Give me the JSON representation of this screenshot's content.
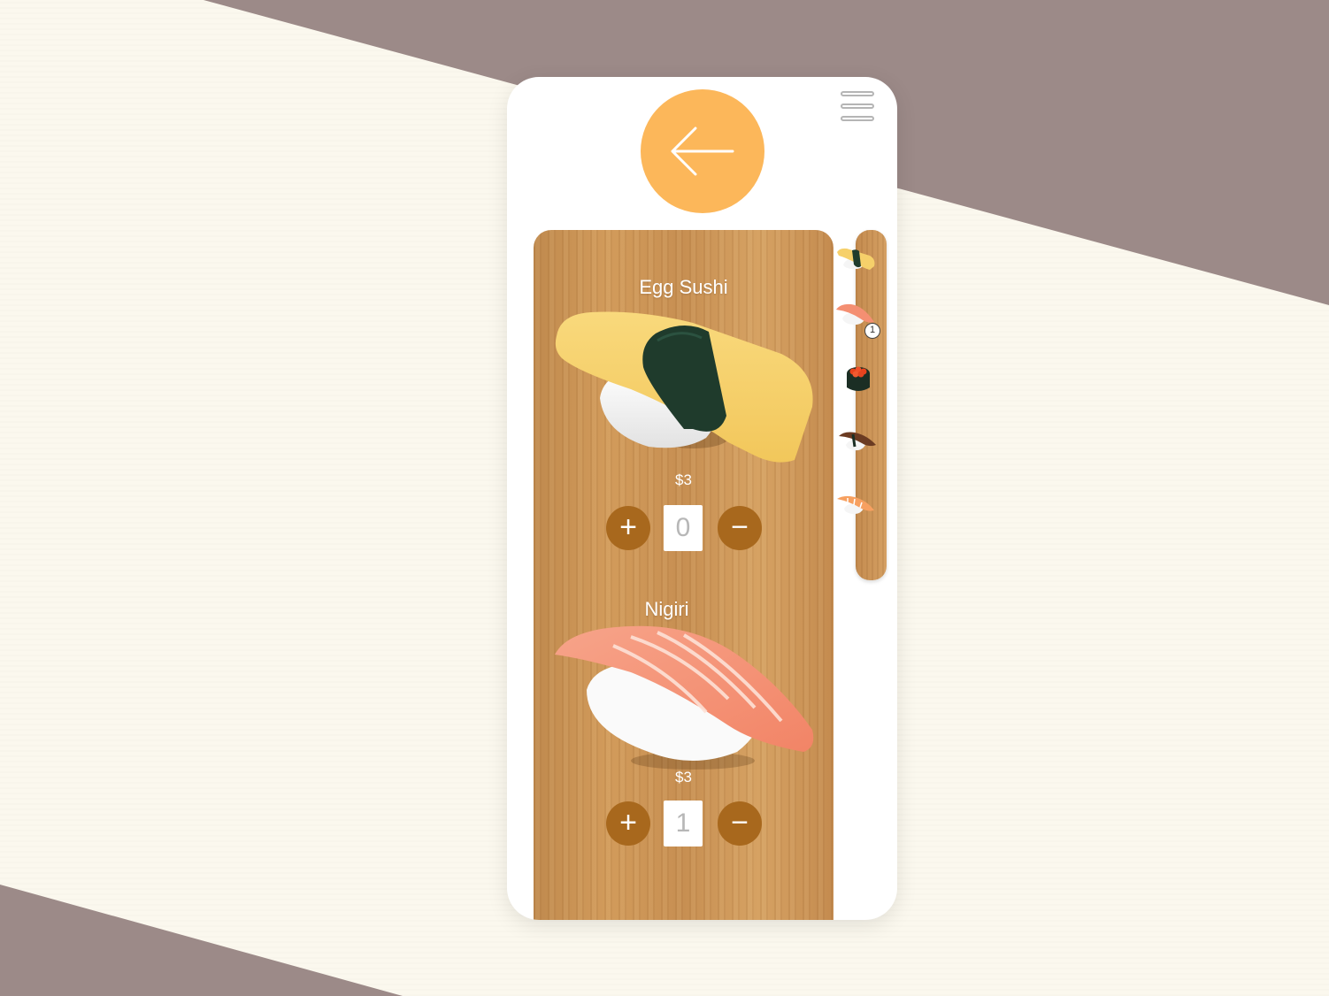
{
  "app": {
    "menu_icon": "hamburger-icon",
    "back_icon": "arrow-left-icon",
    "accent_color": "#fcb75a",
    "button_color": "#a8681d"
  },
  "menu_items": [
    {
      "name": "Egg Sushi",
      "price": "$3",
      "quantity": "0",
      "plus_label": "+",
      "minus_label": "−"
    },
    {
      "name": "Nigiri",
      "price": "$3",
      "quantity": "1",
      "plus_label": "+",
      "minus_label": "−"
    }
  ],
  "sidebar": {
    "thumbnails": [
      "egg-sushi-thumb-icon",
      "nigiri-thumb-icon",
      "ikura-thumb-icon",
      "eel-thumb-icon",
      "shrimp-thumb-icon"
    ],
    "cart_badge": "1"
  }
}
